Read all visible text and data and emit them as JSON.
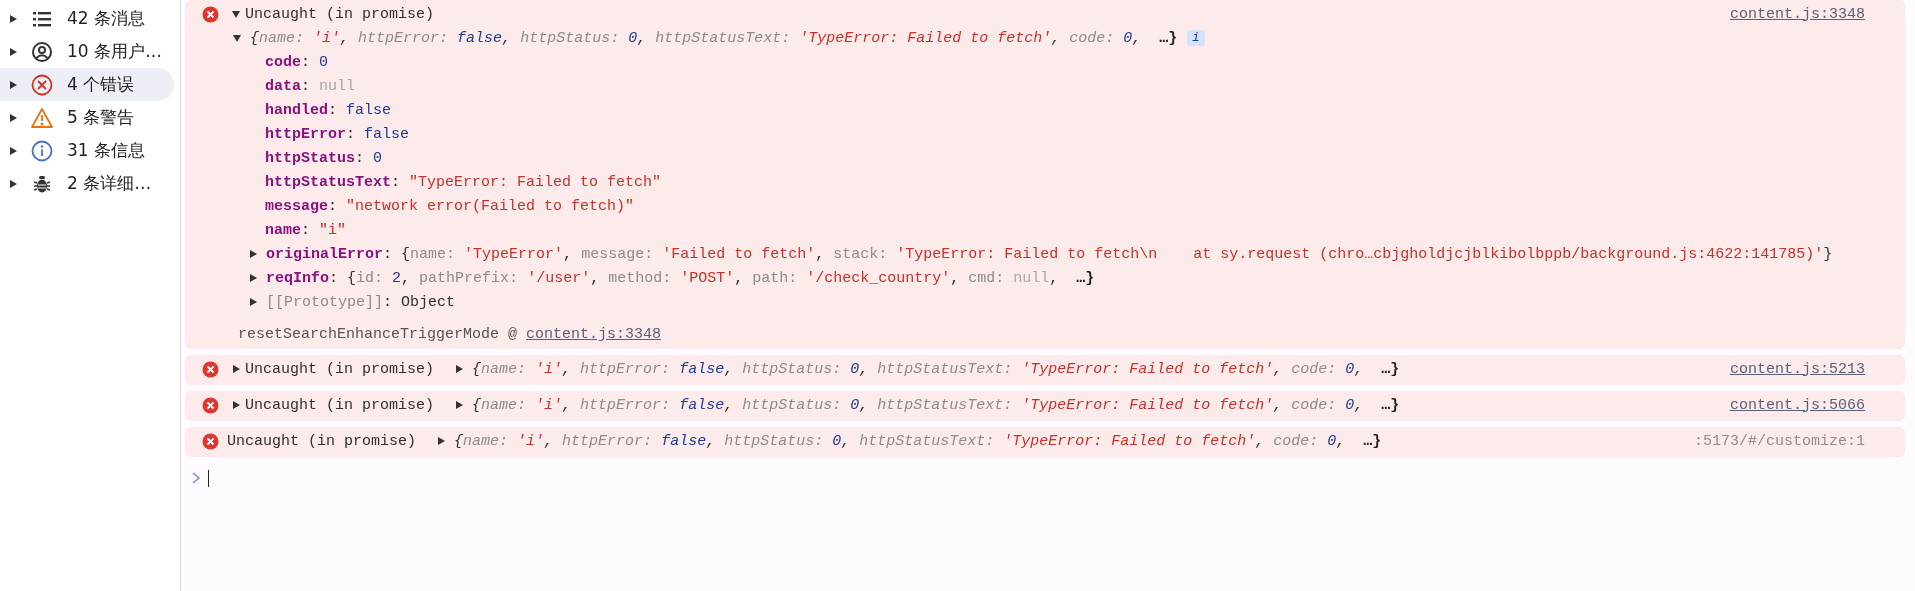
{
  "sidebar": {
    "items": [
      {
        "label": "42 条消息",
        "kind": "list",
        "selected": false
      },
      {
        "label": "10 条用户…",
        "kind": "user",
        "selected": false
      },
      {
        "label": "4 个错误",
        "kind": "error",
        "selected": true
      },
      {
        "label": "5 条警告",
        "kind": "warning",
        "selected": false
      },
      {
        "label": "31 条信息",
        "kind": "info",
        "selected": false
      },
      {
        "label": "2 条详细…",
        "kind": "verbose",
        "selected": false
      }
    ]
  },
  "messages": [
    {
      "kind": "error",
      "toggle": true,
      "expanded": true,
      "title": "Uncaught (in promise)",
      "source": {
        "text": "content.js:3348",
        "kind": "link"
      },
      "object": {
        "expanded": true,
        "badge": "i",
        "preview": [
          {
            "text": "{",
            "kind": "punct"
          },
          {
            "text": "name: ",
            "kind": "key"
          },
          {
            "text": "'i'",
            "kind": "string"
          },
          {
            "text": ", ",
            "kind": "punct"
          },
          {
            "text": "httpError: ",
            "kind": "key"
          },
          {
            "text": "false",
            "kind": "boolean"
          },
          {
            "text": ", ",
            "kind": "punct"
          },
          {
            "text": "httpStatus: ",
            "kind": "key"
          },
          {
            "text": "0",
            "kind": "number"
          },
          {
            "text": ", ",
            "kind": "punct"
          },
          {
            "text": "httpStatusText: ",
            "kind": "key"
          },
          {
            "text": "'TypeError: Failed to fetch'",
            "kind": "string"
          },
          {
            "text": ", ",
            "kind": "punct"
          },
          {
            "text": "code: ",
            "kind": "key"
          },
          {
            "text": "0",
            "kind": "number"
          },
          {
            "text": ",  ",
            "kind": "punct"
          },
          {
            "text": "…}",
            "kind": "more"
          }
        ],
        "properties": [
          {
            "kind": "leaf",
            "segments": [
              {
                "text": "code",
                "kind": "property"
              },
              {
                "text": ": ",
                "kind": "punct"
              },
              {
                "text": "0",
                "kind": "number"
              }
            ]
          },
          {
            "kind": "leaf",
            "segments": [
              {
                "text": "data",
                "kind": "property"
              },
              {
                "text": ": ",
                "kind": "punct"
              },
              {
                "text": "null",
                "kind": "null"
              }
            ]
          },
          {
            "kind": "leaf",
            "segments": [
              {
                "text": "handled",
                "kind": "property"
              },
              {
                "text": ": ",
                "kind": "punct"
              },
              {
                "text": "false",
                "kind": "boolean"
              }
            ]
          },
          {
            "kind": "leaf",
            "segments": [
              {
                "text": "httpError",
                "kind": "property"
              },
              {
                "text": ": ",
                "kind": "punct"
              },
              {
                "text": "false",
                "kind": "boolean"
              }
            ]
          },
          {
            "kind": "leaf",
            "segments": [
              {
                "text": "httpStatus",
                "kind": "property"
              },
              {
                "text": ": ",
                "kind": "punct"
              },
              {
                "text": "0",
                "kind": "number"
              }
            ]
          },
          {
            "kind": "leaf",
            "segments": [
              {
                "text": "httpStatusText",
                "kind": "property"
              },
              {
                "text": ": ",
                "kind": "punct"
              },
              {
                "text": "\"TypeError: Failed to fetch\"",
                "kind": "string"
              }
            ]
          },
          {
            "kind": "leaf",
            "segments": [
              {
                "text": "message",
                "kind": "property"
              },
              {
                "text": ": ",
                "kind": "punct"
              },
              {
                "text": "\"network error(Failed to fetch)\"",
                "kind": "string"
              }
            ]
          },
          {
            "kind": "leaf",
            "segments": [
              {
                "text": "name",
                "kind": "property"
              },
              {
                "text": ": ",
                "kind": "punct"
              },
              {
                "text": "\"i\"",
                "kind": "string"
              }
            ]
          },
          {
            "kind": "node",
            "expanded": false,
            "segments": [
              {
                "text": "originalError",
                "kind": "property"
              },
              {
                "text": ": ",
                "kind": "punct"
              },
              {
                "text": "{",
                "kind": "punct"
              },
              {
                "text": "name: ",
                "kind": "key"
              },
              {
                "text": "'TypeError'",
                "kind": "string"
              },
              {
                "text": ", ",
                "kind": "punct"
              },
              {
                "text": "message: ",
                "kind": "key"
              },
              {
                "text": "'Failed to fetch'",
                "kind": "string"
              },
              {
                "text": ", ",
                "kind": "punct"
              },
              {
                "text": "stack: ",
                "kind": "key"
              },
              {
                "text": "'TypeError: Failed to fetch\\n    at sy.request (chro…cbjgholdjcjblkibolbppb/background.js:4622:141785)'",
                "kind": "string"
              },
              {
                "text": "}",
                "kind": "punct"
              }
            ]
          },
          {
            "kind": "node",
            "expanded": false,
            "segments": [
              {
                "text": "reqInfo",
                "kind": "property"
              },
              {
                "text": ": ",
                "kind": "punct"
              },
              {
                "text": "{",
                "kind": "punct"
              },
              {
                "text": "id: ",
                "kind": "key"
              },
              {
                "text": "2",
                "kind": "number"
              },
              {
                "text": ", ",
                "kind": "punct"
              },
              {
                "text": "pathPrefix: ",
                "kind": "key"
              },
              {
                "text": "'/user'",
                "kind": "string"
              },
              {
                "text": ", ",
                "kind": "punct"
              },
              {
                "text": "method: ",
                "kind": "key"
              },
              {
                "text": "'POST'",
                "kind": "string"
              },
              {
                "text": ", ",
                "kind": "punct"
              },
              {
                "text": "path: ",
                "kind": "key"
              },
              {
                "text": "'/check_country'",
                "kind": "string"
              },
              {
                "text": ", ",
                "kind": "punct"
              },
              {
                "text": "cmd: ",
                "kind": "key"
              },
              {
                "text": "null",
                "kind": "null"
              },
              {
                "text": ",  ",
                "kind": "punct"
              },
              {
                "text": "…}",
                "kind": "more"
              }
            ]
          },
          {
            "kind": "node",
            "expanded": false,
            "segments": [
              {
                "text": "[[Prototype]]",
                "kind": "internal"
              },
              {
                "text": ": ",
                "kind": "punct"
              },
              {
                "text": "Object",
                "kind": "punct"
              }
            ]
          }
        ],
        "stack": {
          "function": "resetSearchEnhanceTriggerMode @ ",
          "link": "content.js:3348"
        }
      }
    },
    {
      "kind": "error",
      "toggle": true,
      "expanded": false,
      "title": "Uncaught (in promise)",
      "source": {
        "text": "content.js:5213",
        "kind": "link"
      },
      "object": {
        "expanded": false,
        "preview": [
          {
            "text": "{",
            "kind": "punct"
          },
          {
            "text": "name: ",
            "kind": "key"
          },
          {
            "text": "'i'",
            "kind": "string"
          },
          {
            "text": ", ",
            "kind": "punct"
          },
          {
            "text": "httpError: ",
            "kind": "key"
          },
          {
            "text": "false",
            "kind": "boolean"
          },
          {
            "text": ", ",
            "kind": "punct"
          },
          {
            "text": "httpStatus: ",
            "kind": "key"
          },
          {
            "text": "0",
            "kind": "number"
          },
          {
            "text": ", ",
            "kind": "punct"
          },
          {
            "text": "httpStatusText: ",
            "kind": "key"
          },
          {
            "text": "'TypeError: Failed to fetch'",
            "kind": "string"
          },
          {
            "text": ", ",
            "kind": "punct"
          },
          {
            "text": "code: ",
            "kind": "key"
          },
          {
            "text": "0",
            "kind": "number"
          },
          {
            "text": ",  ",
            "kind": "punct"
          },
          {
            "text": "…}",
            "kind": "more"
          }
        ]
      }
    },
    {
      "kind": "error",
      "toggle": true,
      "expanded": false,
      "title": "Uncaught (in promise)",
      "source": {
        "text": "content.js:5066",
        "kind": "link"
      },
      "object": {
        "expanded": false,
        "preview": [
          {
            "text": "{",
            "kind": "punct"
          },
          {
            "text": "name: ",
            "kind": "key"
          },
          {
            "text": "'i'",
            "kind": "string"
          },
          {
            "text": ", ",
            "kind": "punct"
          },
          {
            "text": "httpError: ",
            "kind": "key"
          },
          {
            "text": "false",
            "kind": "boolean"
          },
          {
            "text": ", ",
            "kind": "punct"
          },
          {
            "text": "httpStatus: ",
            "kind": "key"
          },
          {
            "text": "0",
            "kind": "number"
          },
          {
            "text": ", ",
            "kind": "punct"
          },
          {
            "text": "httpStatusText: ",
            "kind": "key"
          },
          {
            "text": "'TypeError: Failed to fetch'",
            "kind": "string"
          },
          {
            "text": ", ",
            "kind": "punct"
          },
          {
            "text": "code: ",
            "kind": "key"
          },
          {
            "text": "0",
            "kind": "number"
          },
          {
            "text": ",  ",
            "kind": "punct"
          },
          {
            "text": "…}",
            "kind": "more"
          }
        ]
      }
    },
    {
      "kind": "error",
      "toggle": false,
      "title": "Uncaught (in promise)",
      "source": {
        "text": ":5173/#/customize:1",
        "kind": "plain"
      },
      "object": {
        "expanded": false,
        "preview": [
          {
            "text": "{",
            "kind": "punct"
          },
          {
            "text": "name: ",
            "kind": "key"
          },
          {
            "text": "'i'",
            "kind": "string"
          },
          {
            "text": ", ",
            "kind": "punct"
          },
          {
            "text": "httpError: ",
            "kind": "key"
          },
          {
            "text": "false",
            "kind": "boolean"
          },
          {
            "text": ", ",
            "kind": "punct"
          },
          {
            "text": "httpStatus: ",
            "kind": "key"
          },
          {
            "text": "0",
            "kind": "number"
          },
          {
            "text": ", ",
            "kind": "punct"
          },
          {
            "text": "httpStatusText: ",
            "kind": "key"
          },
          {
            "text": "'TypeError: Failed to fetch'",
            "kind": "string"
          },
          {
            "text": ", ",
            "kind": "punct"
          },
          {
            "text": "code: ",
            "kind": "key"
          },
          {
            "text": "0",
            "kind": "number"
          },
          {
            "text": ",  ",
            "kind": "punct"
          },
          {
            "text": "…}",
            "kind": "more"
          }
        ]
      }
    }
  ]
}
